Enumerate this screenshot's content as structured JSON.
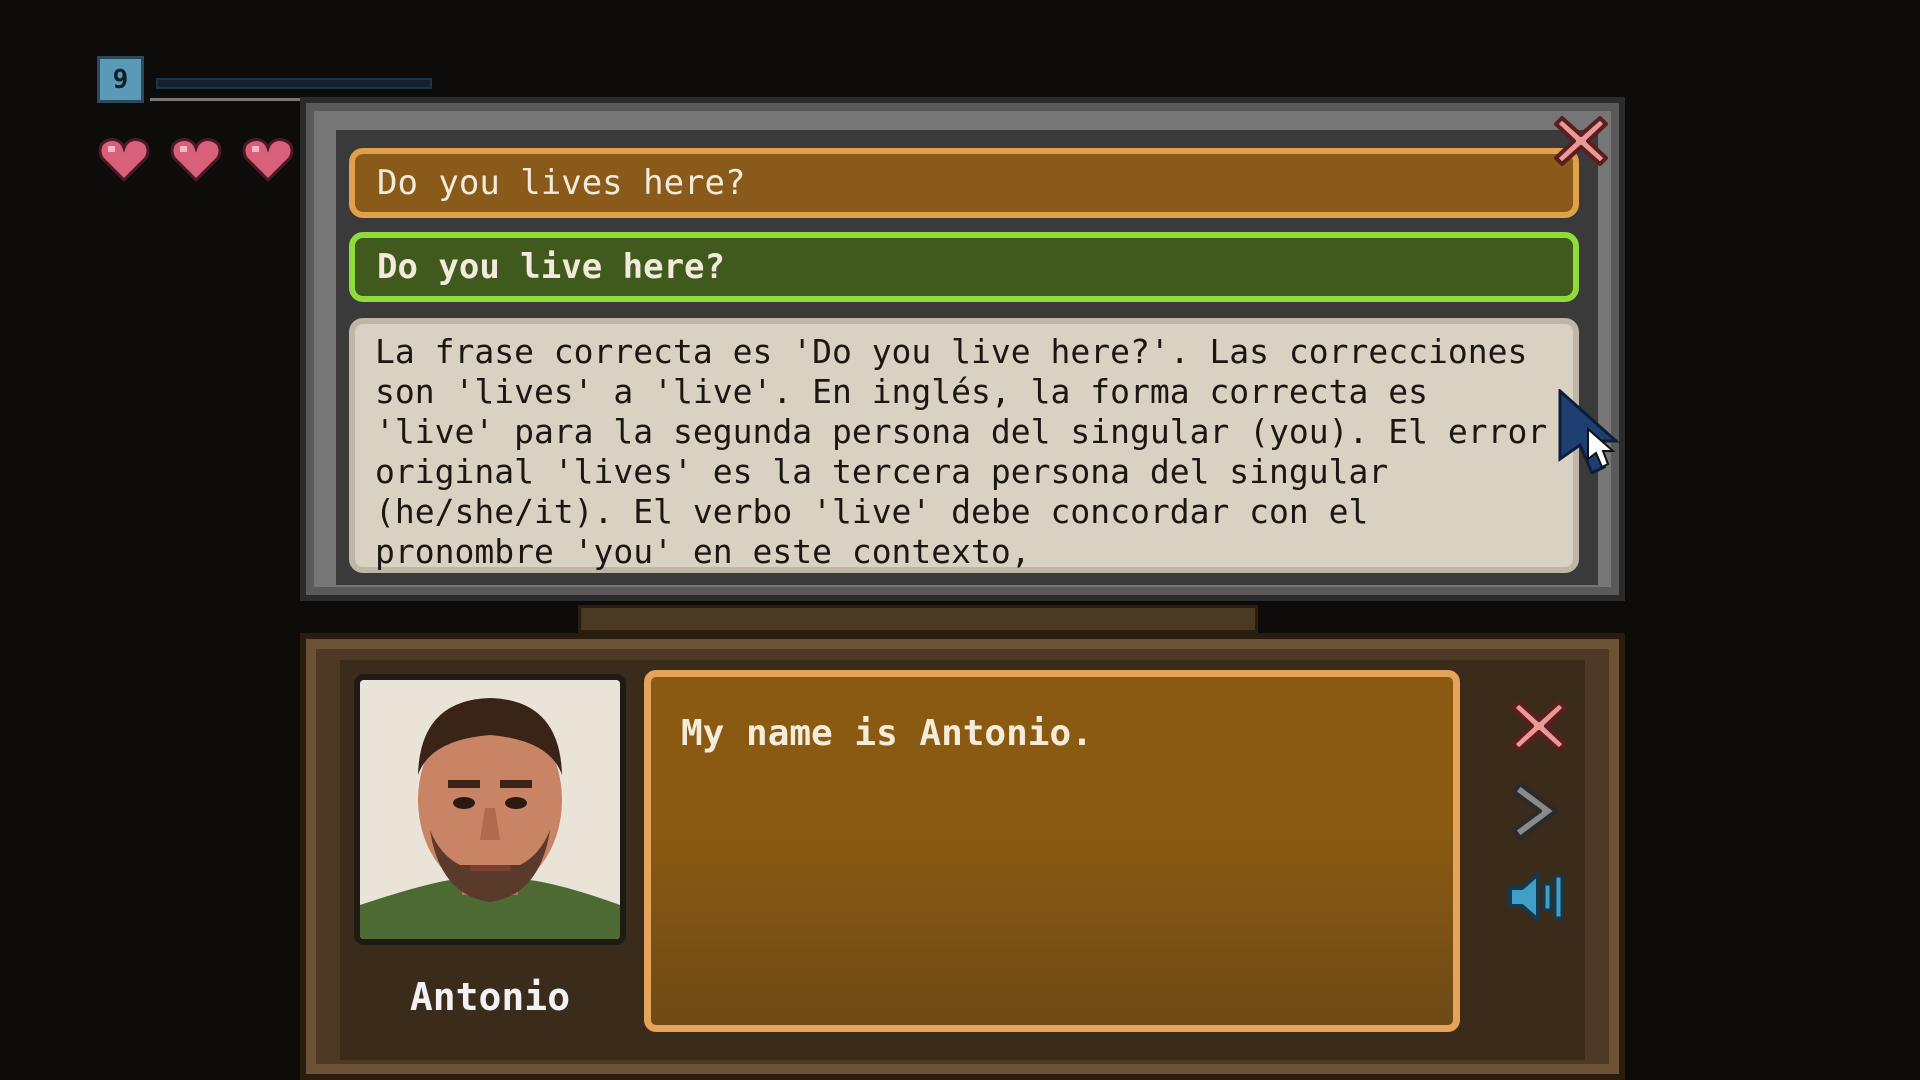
{
  "hud": {
    "level": "9",
    "xp_fraction": 0.0,
    "hearts": 3
  },
  "correction": {
    "incorrect": "Do you lives here?",
    "correct": "Do you live here?",
    "explanation": "La frase correcta es 'Do you live here?'. Las correcciones\nson 'lives' a 'live'. En inglés, la forma correcta es\n'live' para la segunda persona del singular (you). El error\noriginal 'lives' es la tercera persona del singular\n(he/she/it). El verbo 'live' debe concordar con el\npronombre 'you' en este contexto,"
  },
  "dialog": {
    "speaker": "Antonio",
    "text": "My name is Antonio."
  },
  "icons": {
    "close_top": "close-icon",
    "close_dialog": "close-icon",
    "next": "chevron-right-icon",
    "audio": "speaker-icon",
    "cursor": "pointer-cursor-icon"
  },
  "colors": {
    "incorrect_border": "#e0a14a",
    "correct_border": "#8edb3a",
    "heart": "#d8607a",
    "level_badge": "#5a9ab7"
  }
}
